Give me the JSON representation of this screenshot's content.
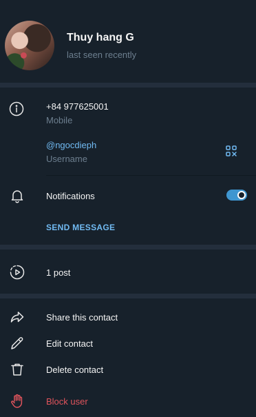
{
  "profile": {
    "name": "Thuy hang G",
    "status": "last seen recently"
  },
  "info": {
    "phone": "+84 977625001",
    "phone_label": "Mobile",
    "username": "@ngocdieph",
    "username_label": "Username"
  },
  "notifications": {
    "label": "Notifications",
    "enabled": true
  },
  "send_message_label": "SEND MESSAGE",
  "posts_label": "1 post",
  "actions": {
    "share": "Share this contact",
    "edit": "Edit contact",
    "delete": "Delete contact",
    "block": "Block user"
  },
  "colors": {
    "background": "#17212b",
    "separator": "#232e3c",
    "accent": "#71baf2",
    "toggle": "#3f96d0",
    "danger": "#e0545c",
    "secondary_text": "#6d7f8f"
  },
  "icons": {
    "info": "info-icon",
    "qr": "qr-code-icon",
    "bell": "bell-icon",
    "posts": "story-play-icon",
    "share": "share-arrow-icon",
    "edit": "pencil-icon",
    "delete": "trash-icon",
    "block": "hand-stop-icon"
  }
}
